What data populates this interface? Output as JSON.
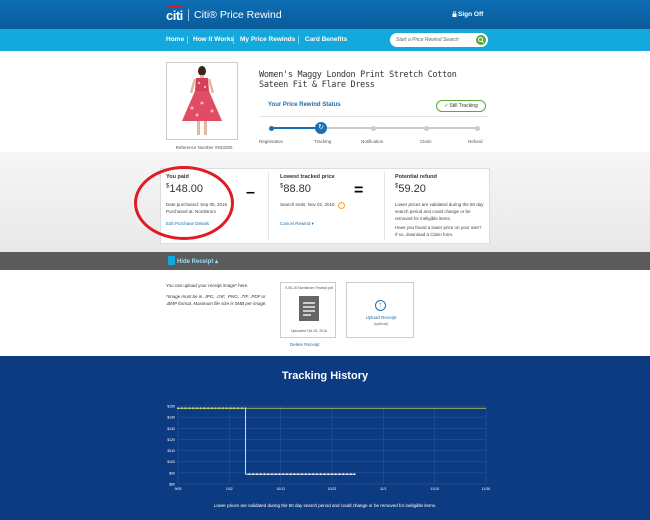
{
  "header": {
    "logo": "citi",
    "title": "Citi® Price Rewind",
    "signoff": "Sign Off",
    "colors": {
      "header": "#0e6fb4",
      "nav": "#14a9dc",
      "accent": "#1a6fb0",
      "success": "#5aa73d",
      "highlight": "#e11b22"
    }
  },
  "nav": {
    "items": [
      {
        "label": "Home"
      },
      {
        "label": "How It Works"
      },
      {
        "label": "My Price Rewinds"
      },
      {
        "label": "Card Benefits"
      }
    ],
    "search_placeholder": "Start a Price Rewind Search",
    "search_icon": "search-icon"
  },
  "product": {
    "title": "Women's Maggy London Print Stretch Cotton Sateen Fit & Flare Dress",
    "reference": "Reference Number #933280"
  },
  "status": {
    "title": "Your Price Rewind Status",
    "badge": "Still Tracking",
    "current_step": "Tracking",
    "steps": [
      "Registration",
      "Tracking",
      "Notification",
      "Claim",
      "Refund"
    ]
  },
  "prices": {
    "paid": {
      "label": "You paid",
      "currency": "$",
      "amount": "148.00",
      "date": "Date purchased:  Sep 05, 2016",
      "store": "Purchased at: Nordstrom",
      "link": "Edit Purchase Details"
    },
    "lowest": {
      "label": "Lowest tracked price",
      "currency": "$",
      "amount": "88.80",
      "search_end": "Search ends:  Nov 02, 2016",
      "link": "Cancel Rewind"
    },
    "refund": {
      "label": "Potential refund",
      "currency": "$",
      "amount": "59.20",
      "note1": "Lower prices are validated during the 60 day search period and could change or be removed for ineligible items.",
      "note2": "Have you found a lower price on your own? If so, download a Claim form."
    }
  },
  "receipt": {
    "toggle": "Hide Receipt",
    "info": "You can upload your receipt image* here.",
    "note": "*Image must be in .JPG, .GIF, .PNG, .TIF, .PDF or .BMP format. Maximum file size is 5MB per image.",
    "file_name": "9-05-16 Nordstrom Receipt.pdf",
    "uploaded": "Uploaded Oct 25, 2016",
    "delete": "Delete Receipt",
    "upload_label": "Upload Receipt",
    "upload_optional": "(optional)"
  },
  "history": {
    "title": "Tracking History",
    "footer": "Lower prices are validated during the 60 day search period and could change or be removed for ineligible items."
  },
  "chart_data": {
    "type": "line",
    "title": "Tracking History",
    "x_ticks": [
      "9/05",
      "10/2",
      "10/12",
      "10/22",
      "11/1",
      "11/15",
      "11/30"
    ],
    "y_ticks": [
      150,
      140,
      130,
      120,
      110,
      100,
      90,
      80
    ],
    "ylim": [
      80,
      150
    ],
    "grid": true,
    "series": [
      {
        "color": "#ffffff",
        "points": [
          [
            0,
            148
          ],
          [
            1,
            148
          ],
          [
            2,
            148
          ],
          [
            3,
            148
          ],
          [
            4,
            148
          ],
          [
            5,
            148
          ],
          [
            6,
            148
          ],
          [
            7,
            148
          ],
          [
            8,
            148
          ],
          [
            9,
            148
          ],
          [
            10,
            148
          ],
          [
            11,
            148
          ],
          [
            12,
            148
          ],
          [
            13,
            148
          ],
          [
            14,
            148
          ],
          [
            15,
            148
          ],
          [
            16,
            148
          ],
          [
            17,
            148
          ],
          [
            18,
            148
          ],
          [
            19,
            88.8
          ],
          [
            20,
            88.8
          ],
          [
            21,
            88.8
          ],
          [
            22,
            88.8
          ],
          [
            23,
            88.8
          ],
          [
            24,
            88.8
          ],
          [
            25,
            88.8
          ],
          [
            26,
            88.8
          ],
          [
            27,
            88.8
          ],
          [
            28,
            88.8
          ],
          [
            29,
            88.8
          ],
          [
            30,
            88.8
          ],
          [
            31,
            88.8
          ],
          [
            32,
            88.8
          ],
          [
            33,
            88.8
          ],
          [
            34,
            88.8
          ],
          [
            35,
            88.8
          ],
          [
            36,
            88.8
          ],
          [
            37,
            88.8
          ],
          [
            38,
            88.8
          ],
          [
            39,
            88.8
          ],
          [
            40,
            88.8
          ],
          [
            41,
            88.8
          ],
          [
            42,
            88.8
          ],
          [
            43,
            88.8
          ],
          [
            44,
            88.8
          ],
          [
            45,
            88.8
          ],
          [
            46,
            88.8
          ],
          [
            47,
            88.8
          ]
        ]
      },
      {
        "color": "#c9d63b",
        "points": [
          [
            0,
            148
          ],
          [
            82,
            148
          ]
        ]
      }
    ],
    "x_max": 82
  }
}
